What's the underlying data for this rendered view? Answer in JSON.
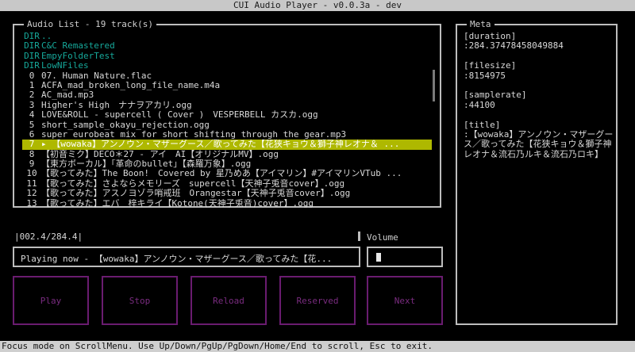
{
  "window": {
    "title": "CUI Audio Player - v0.0.3a - dev"
  },
  "list": {
    "title": "Audio List - 19 track(s)",
    "rows": [
      {
        "idx": "DIR",
        "name": "..",
        "dir": true
      },
      {
        "idx": "DIR",
        "name": "C&C Remastered",
        "dir": true
      },
      {
        "idx": "DIR",
        "name": "EmpyFolderTest",
        "dir": true
      },
      {
        "idx": "DIR",
        "name": "LowNFiles",
        "dir": true
      },
      {
        "idx": "0",
        "name": "07. Human Nature.flac"
      },
      {
        "idx": "1",
        "name": "ACFA_mad_broken_long_file_name.m4a"
      },
      {
        "idx": "2",
        "name": "AC_mad.mp3"
      },
      {
        "idx": "3",
        "name": "Higher's High　ナナヲアカリ.ogg"
      },
      {
        "idx": "4",
        "name": "LOVE&ROLL - supercell ( Cover )　VESPERBELL カスカ.ogg"
      },
      {
        "idx": "5",
        "name": "short_sample_okayu_rejection.ogg"
      },
      {
        "idx": "6",
        "name": "super eurobeat mix for short shifting through the gear.mp3"
      },
      {
        "idx": "7",
        "name": "▸ 【wowaka】アンノウン・マザーグース／歌ってみた【花狭キョウ＆獅子神レオナ＆ ...",
        "selected": true
      },
      {
        "idx": "8",
        "name": "【初音ミク】DECO＊27 - アイ　AI【オリジナルMV】.ogg"
      },
      {
        "idx": "9",
        "name": "【東方ボーカル】「革命のbullet」【森羅万象】.ogg"
      },
      {
        "idx": "10",
        "name": "【歌ってみた】The Boon!　Covered by 星乃めあ【アイマリン】#アイマリンVTub ..."
      },
      {
        "idx": "11",
        "name": "【歌ってみた】さよならメモリーズ　supercell【天神子兎音cover】.ogg"
      },
      {
        "idx": "12",
        "name": "【歌ってみた】アスノヨゾラ哨戒班　Orangestar【天神子兎音cover】.ogg"
      },
      {
        "idx": "13",
        "name": "【歌ってみた】エバ　梓キライ【Kotone(天神子兎音)cover】.ogg"
      }
    ]
  },
  "meta": {
    "title": "Meta",
    "duration_label": "[duration]",
    "duration_value": ":284.37478458049884",
    "filesize_label": "[filesize]",
    "filesize_value": ":8154975",
    "samplerate_label": "[samplerate]",
    "samplerate_value": ":44100",
    "title_label": "[title]",
    "title_value": ":【wowaka】アンノウン・マザーグース／歌ってみた【花狭キョウ＆獅子神レオナ＆流石乃ルキ＆流石乃ロキ】"
  },
  "progress": {
    "text": "|002.4/284.4|",
    "fraction": 0.0084
  },
  "volume": {
    "label": "Volume"
  },
  "now_playing": {
    "text": "Playing now - 【wowaka】アンノウン・マザーグース／歌ってみた【花..."
  },
  "buttons": {
    "play": "Play",
    "stop": "Stop",
    "reload": "Reload",
    "reserved": "Reserved",
    "next": "Next"
  },
  "status": {
    "text": "Focus mode on ScrollMenu. Use Up/Down/PgUp/PgDown/Home/End to scroll, Esc to exit."
  },
  "colors": {
    "dir": "#16a89a",
    "selected": "#aeb800",
    "button_border": "#6a1c70"
  }
}
